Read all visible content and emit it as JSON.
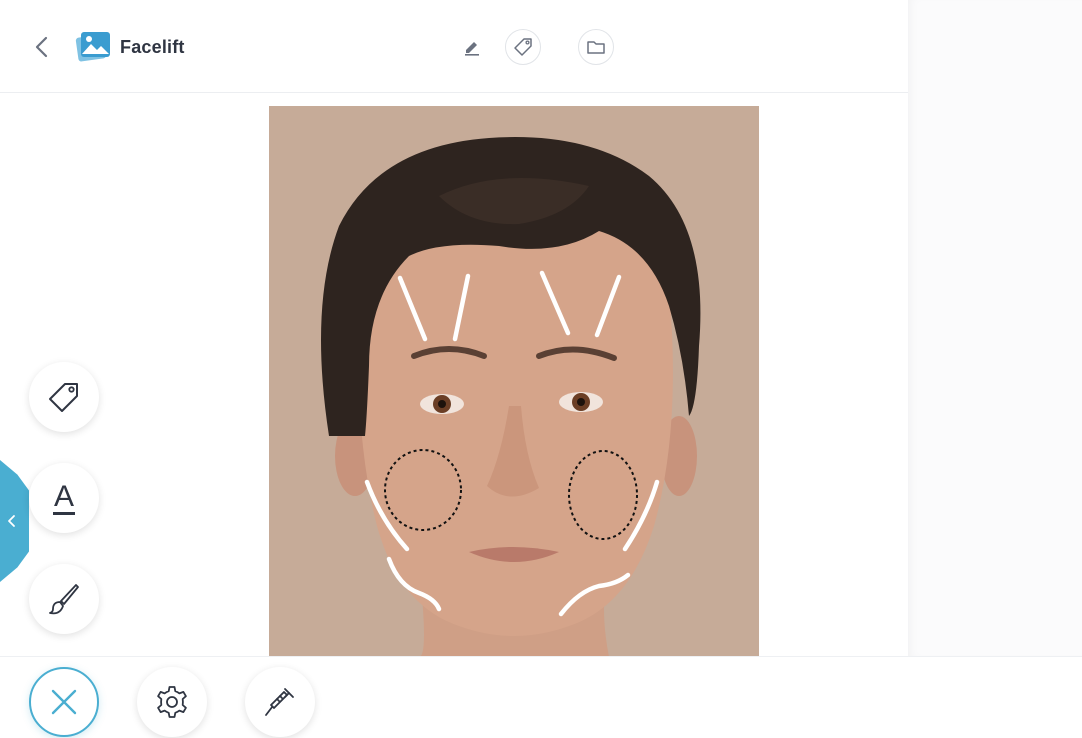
{
  "header": {
    "title": "Facelift",
    "icons": {
      "back": "chevron-left-icon",
      "app": "image-icon",
      "edit": "pencil-icon",
      "tag": "tag-icon",
      "folder": "folder-icon"
    }
  },
  "toolbar_left": {
    "tools": [
      "tag-icon",
      "text-icon",
      "brush-icon"
    ],
    "text_tool_glyph": "A",
    "collapse_tab_icon": "chevron-left-icon"
  },
  "bottom_bar": {
    "buttons": [
      "close-icon",
      "gear-icon",
      "syringe-icon"
    ]
  },
  "colors": {
    "accent": "#4aaed1",
    "text": "#2f3542",
    "photo_background": "#c6ab98",
    "annotation_lines": "#ffffff",
    "annotation_circles": "#111111"
  },
  "photo": {
    "subject": "face-portrait-with-facelift-annotations"
  }
}
